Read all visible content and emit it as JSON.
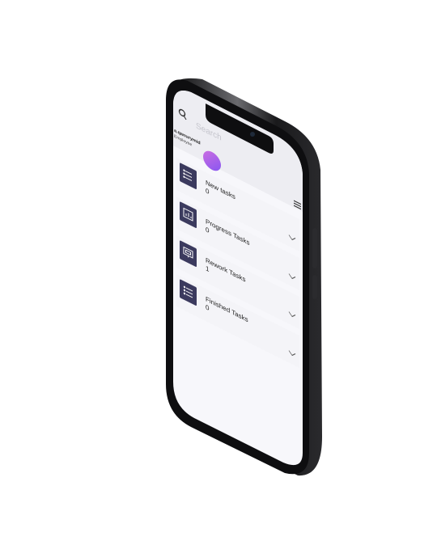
{
  "app": {
    "search": {
      "placeholder": "Search"
    },
    "user": {
      "name": "a.qanurymid",
      "role": "Employee"
    },
    "tasks": [
      {
        "label": "New tasks",
        "count": "0",
        "icon": "list-icon"
      },
      {
        "label": "Progress Tasks",
        "count": "0",
        "icon": "chart-icon"
      },
      {
        "label": "Rework Tasks",
        "count": "1",
        "icon": "monitor-icon"
      },
      {
        "label": "Finished Tasks",
        "count": "0",
        "icon": "checklist-icon"
      }
    ],
    "colors": {
      "tile": "#3b3a5e",
      "avatar_start": "#c46be0",
      "avatar_end": "#8a55f0",
      "screen": "#f7f7fb",
      "frame": "#0e0e10"
    }
  }
}
